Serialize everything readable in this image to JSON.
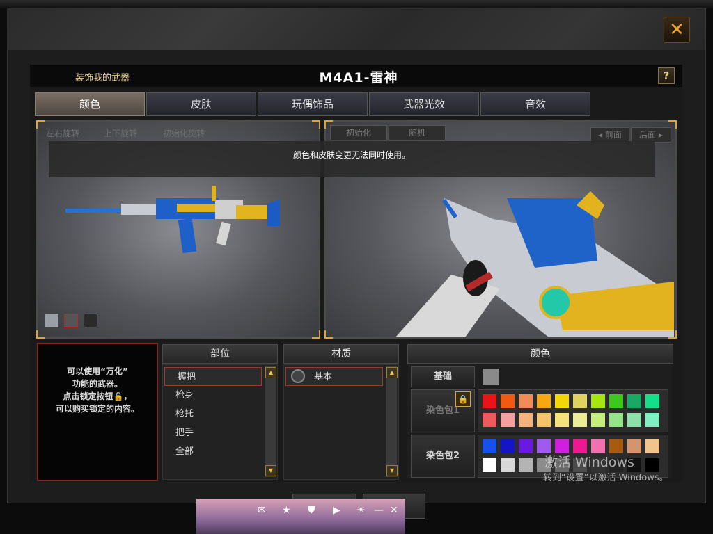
{
  "window": {
    "header_left": "装饰我的武器",
    "title": "M4A1-雷神",
    "close_glyph": "✕",
    "help_glyph": "?"
  },
  "tabs": [
    {
      "label": "颜色",
      "active": true
    },
    {
      "label": "皮肤",
      "active": false
    },
    {
      "label": "玩偶饰品",
      "active": false
    },
    {
      "label": "武器光效",
      "active": false
    },
    {
      "label": "音效",
      "active": false
    }
  ],
  "viewer": {
    "controls": [
      "左右旋转",
      "上下旋转",
      "初始化旋转"
    ],
    "reset_label": "初始化",
    "random_label": "随机",
    "prev_label": "◂ 前面",
    "next_label": "后面 ▸",
    "notice": "颜色和皮肤变更无法同时使用。"
  },
  "lock_panel": {
    "lines": [
      "可以使用“万化”",
      "功能的武器。",
      "点击锁定按钮🔒，",
      "可以购买锁定的内容。"
    ]
  },
  "parts": {
    "header": "部位",
    "items": [
      "握把",
      "枪身",
      "枪托",
      "把手",
      "全部"
    ],
    "selected": 0
  },
  "material": {
    "header": "材质",
    "items": [
      "基本"
    ]
  },
  "color": {
    "header": "颜色",
    "base_label": "基础",
    "pack1_label": "染色包1",
    "pack2_label": "染色包2",
    "base_swatch": "#8a8a8a",
    "pack1_row1": [
      "#e8141a",
      "#f25a12",
      "#f18b57",
      "#f7a810",
      "#f4d606",
      "#dfd25e",
      "#a6e60e",
      "#3fc81c",
      "#1aa864",
      "#12e08a"
    ],
    "pack1_row2": [
      "#ef5a5c",
      "#f5a0a0",
      "#f4b27c",
      "#f5c46a",
      "#f6e27a",
      "#ecec98",
      "#c6ee7c",
      "#96e48a",
      "#8ee0a8",
      "#7ef0c2"
    ],
    "pack2_row1": [
      "#1650ee",
      "#1414c8",
      "#6a1ae0",
      "#a15af0",
      "#d21ee0",
      "#f01890",
      "#f070b0",
      "#a85a10",
      "#d4946e",
      "#f0c48a"
    ],
    "pack2_row2": [
      "#ffffff",
      "#d8d8d8",
      "#b4b4b4",
      "#8c8c8c",
      "#6a6a6a",
      "#4a4a4a",
      "#333333",
      "#222222",
      "#111111",
      "#000000"
    ]
  },
  "watermark": {
    "line1": "激活 Windows",
    "line2": "转到“设置”以激活 Windows。"
  },
  "accent": {
    "gold": "#d9a53a",
    "red": "#9b3b2b"
  }
}
